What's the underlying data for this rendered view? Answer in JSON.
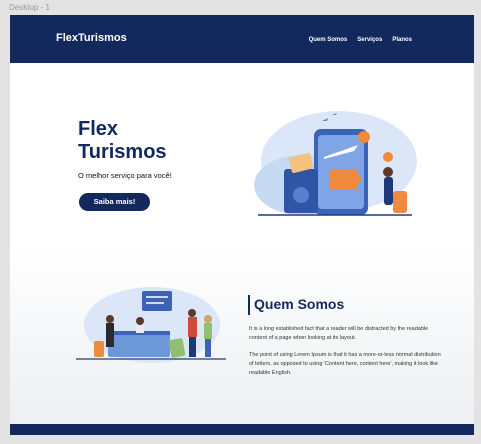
{
  "frame": {
    "label": "Desktop - 1"
  },
  "nav": {
    "brand": "FlexTurismos",
    "links": [
      "Quem Somos",
      "Serviços",
      "Planos"
    ]
  },
  "hero": {
    "title": "Flex Turismos",
    "subtitle": "O melhor serviço para você!",
    "cta": "Saiba mais!"
  },
  "about": {
    "title": "Quem Somos",
    "paragraphs": [
      "It is a long established fact that a reader will be distracted by the readable content of a page when looking at its layout.",
      "The point of using Lorem Ipsum is that it has a more-or-less normal distribution of letters, as opposed to using 'Content here, content here', making it look like readable English."
    ]
  },
  "colors": {
    "primary": "#13295e",
    "accent": "#f08a3c",
    "light_blue": "#bcd3f2"
  }
}
